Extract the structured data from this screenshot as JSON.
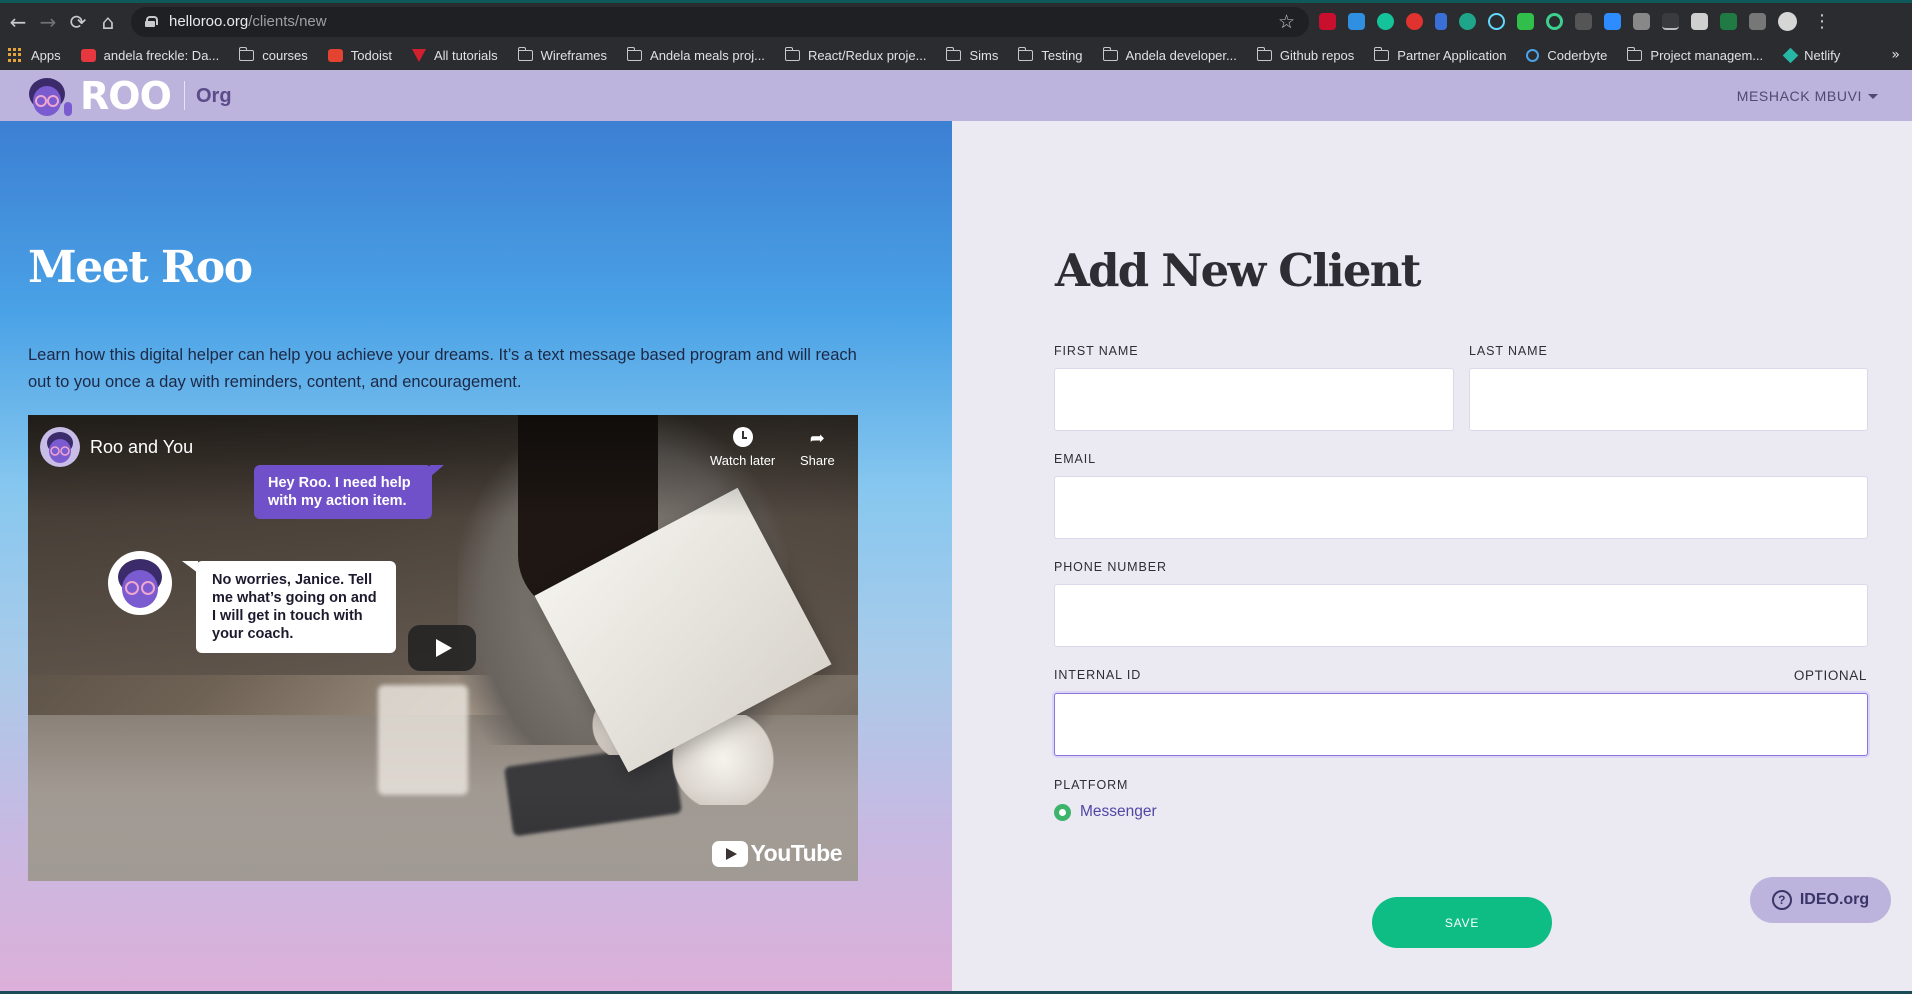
{
  "browser": {
    "url_host": "helloroo.org",
    "url_path": "/clients/new",
    "nav": {
      "back": "←",
      "forward": "→",
      "reload": "⟳",
      "home": "⌂"
    },
    "star": "☆",
    "menu": "⋮",
    "bookmarks_more": "»",
    "bookmarks": [
      {
        "label": "Apps",
        "icon": "apps-grid-icon"
      },
      {
        "label": "andela freckle: Da...",
        "icon": "freckle-icon"
      },
      {
        "label": "courses",
        "icon": "folder-icon"
      },
      {
        "label": "Todoist",
        "icon": "todoist-icon"
      },
      {
        "label": "All tutorials",
        "icon": "tutorials-icon"
      },
      {
        "label": "Wireframes",
        "icon": "folder-icon"
      },
      {
        "label": "Andela meals proj...",
        "icon": "folder-icon"
      },
      {
        "label": "React/Redux proje...",
        "icon": "folder-icon"
      },
      {
        "label": "Sims",
        "icon": "folder-icon"
      },
      {
        "label": "Testing",
        "icon": "folder-icon"
      },
      {
        "label": "Andela developer...",
        "icon": "folder-icon"
      },
      {
        "label": "Github repos",
        "icon": "folder-icon"
      },
      {
        "label": "Partner Application",
        "icon": "folder-icon"
      },
      {
        "label": "Coderbyte",
        "icon": "coderbyte-icon"
      },
      {
        "label": "Project managem...",
        "icon": "folder-icon"
      },
      {
        "label": "Netlify",
        "icon": "netlify-icon"
      }
    ]
  },
  "header": {
    "logo_text": "ROO",
    "org_label": "Org",
    "user_name": "MESHACK MBUVI"
  },
  "intro": {
    "title": "Meet Roo",
    "body": "Learn how this digital helper can help you achieve your dreams. It’s a text message based program and will reach out to you once a day with reminders, content, and encouragement."
  },
  "video": {
    "title": "Roo and You",
    "watch_later": "Watch later",
    "share": "Share",
    "bubble_user": "Hey Roo. I need help with my action item.",
    "bubble_roo": "No worries, Janice. Tell me what’s going on and I will get in touch with your coach.",
    "youtube": "YouTube"
  },
  "form": {
    "title": "Add New Client",
    "first_name_label": "FIRST NAME",
    "first_name_value": "",
    "last_name_label": "LAST NAME",
    "last_name_value": "",
    "email_label": "EMAIL",
    "email_value": "",
    "phone_label": "PHONE NUMBER",
    "phone_value": "",
    "internal_id_label": "INTERNAL ID",
    "internal_id_optional": "OPTIONAL",
    "internal_id_value": "",
    "platform_label": "PLATFORM",
    "platform_option": "Messenger",
    "save_label": "SAVE"
  },
  "help": {
    "label": "IDEO.org",
    "icon": "?"
  },
  "colors": {
    "header_bg": "#bcb4dc",
    "save_green": "#0dbd84",
    "radio_green": "#3cb56b",
    "accent_purple": "#7151c9"
  }
}
